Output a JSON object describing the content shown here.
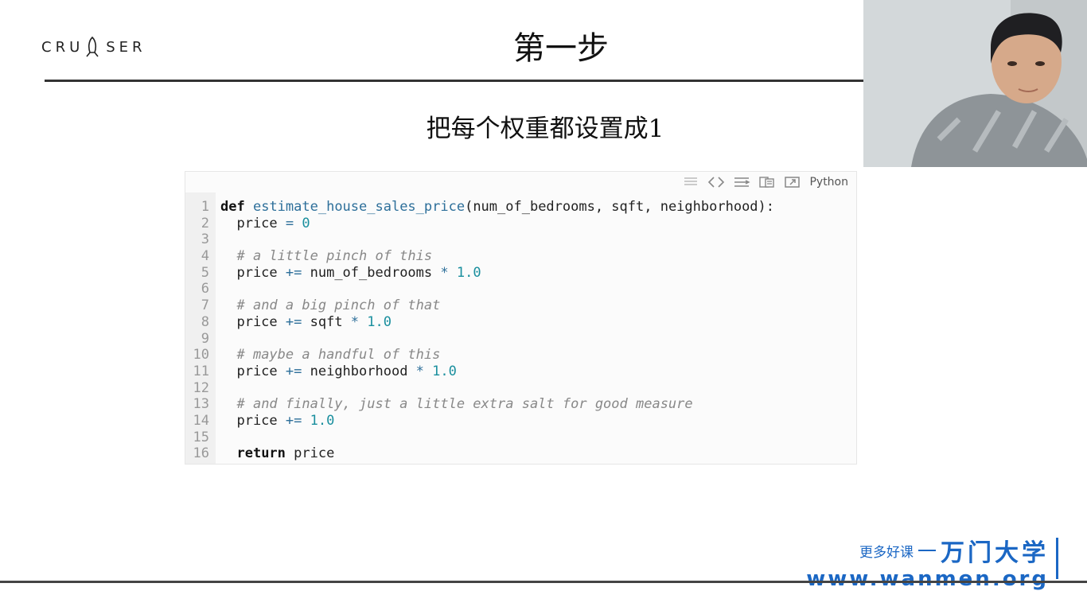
{
  "logo": {
    "text": "CRUISER",
    "part1": "CRU",
    "part2": "SER"
  },
  "slide": {
    "title": "第一步",
    "subtitle": "把每个权重都设置成1"
  },
  "code": {
    "language": "Python",
    "toolbar_icons": [
      "list-icon",
      "code-brackets-icon",
      "wrap-icon",
      "copy-icon",
      "popout-icon"
    ],
    "lines": [
      {
        "n": "1",
        "tokens": [
          {
            "t": "def",
            "c": "kw"
          },
          {
            "t": " "
          },
          {
            "t": "estimate_house_sales_price",
            "c": "fn"
          },
          {
            "t": "(num_of_bedrooms, sqft, neighborhood):"
          }
        ]
      },
      {
        "n": "2",
        "tokens": [
          {
            "t": "  price "
          },
          {
            "t": "=",
            "c": "op"
          },
          {
            "t": " "
          },
          {
            "t": "0",
            "c": "num"
          }
        ]
      },
      {
        "n": "3",
        "tokens": []
      },
      {
        "n": "4",
        "tokens": [
          {
            "t": "  "
          },
          {
            "t": "# a little pinch of this",
            "c": "cmt"
          }
        ]
      },
      {
        "n": "5",
        "tokens": [
          {
            "t": "  price "
          },
          {
            "t": "+=",
            "c": "op"
          },
          {
            "t": " num_of_bedrooms "
          },
          {
            "t": "*",
            "c": "op"
          },
          {
            "t": " "
          },
          {
            "t": "1.0",
            "c": "num"
          }
        ]
      },
      {
        "n": "6",
        "tokens": []
      },
      {
        "n": "7",
        "tokens": [
          {
            "t": "  "
          },
          {
            "t": "# and a big pinch of that",
            "c": "cmt"
          }
        ]
      },
      {
        "n": "8",
        "tokens": [
          {
            "t": "  price "
          },
          {
            "t": "+=",
            "c": "op"
          },
          {
            "t": " sqft "
          },
          {
            "t": "*",
            "c": "op"
          },
          {
            "t": " "
          },
          {
            "t": "1.0",
            "c": "num"
          }
        ]
      },
      {
        "n": "9",
        "tokens": []
      },
      {
        "n": "10",
        "tokens": [
          {
            "t": "  "
          },
          {
            "t": "# maybe a handful of this",
            "c": "cmt"
          }
        ]
      },
      {
        "n": "11",
        "tokens": [
          {
            "t": "  price "
          },
          {
            "t": "+=",
            "c": "op"
          },
          {
            "t": " neighborhood "
          },
          {
            "t": "*",
            "c": "op"
          },
          {
            "t": " "
          },
          {
            "t": "1.0",
            "c": "num"
          }
        ]
      },
      {
        "n": "12",
        "tokens": []
      },
      {
        "n": "13",
        "tokens": [
          {
            "t": "  "
          },
          {
            "t": "# and finally, just a little extra salt for good measure",
            "c": "cmt"
          }
        ]
      },
      {
        "n": "14",
        "tokens": [
          {
            "t": "  price "
          },
          {
            "t": "+=",
            "c": "op"
          },
          {
            "t": " "
          },
          {
            "t": "1.0",
            "c": "num"
          }
        ]
      },
      {
        "n": "15",
        "tokens": []
      },
      {
        "n": "16",
        "tokens": [
          {
            "t": "  "
          },
          {
            "t": "return",
            "c": "kw"
          },
          {
            "t": " price"
          }
        ]
      }
    ]
  },
  "watermark": {
    "tagline": "更多好课",
    "brand": "万门大学",
    "url": "www.wanmen.org"
  },
  "colors": {
    "accent": "#1b67c4",
    "comment": "#888888",
    "number": "#1a8f9e",
    "function": "#2d6f9a"
  }
}
